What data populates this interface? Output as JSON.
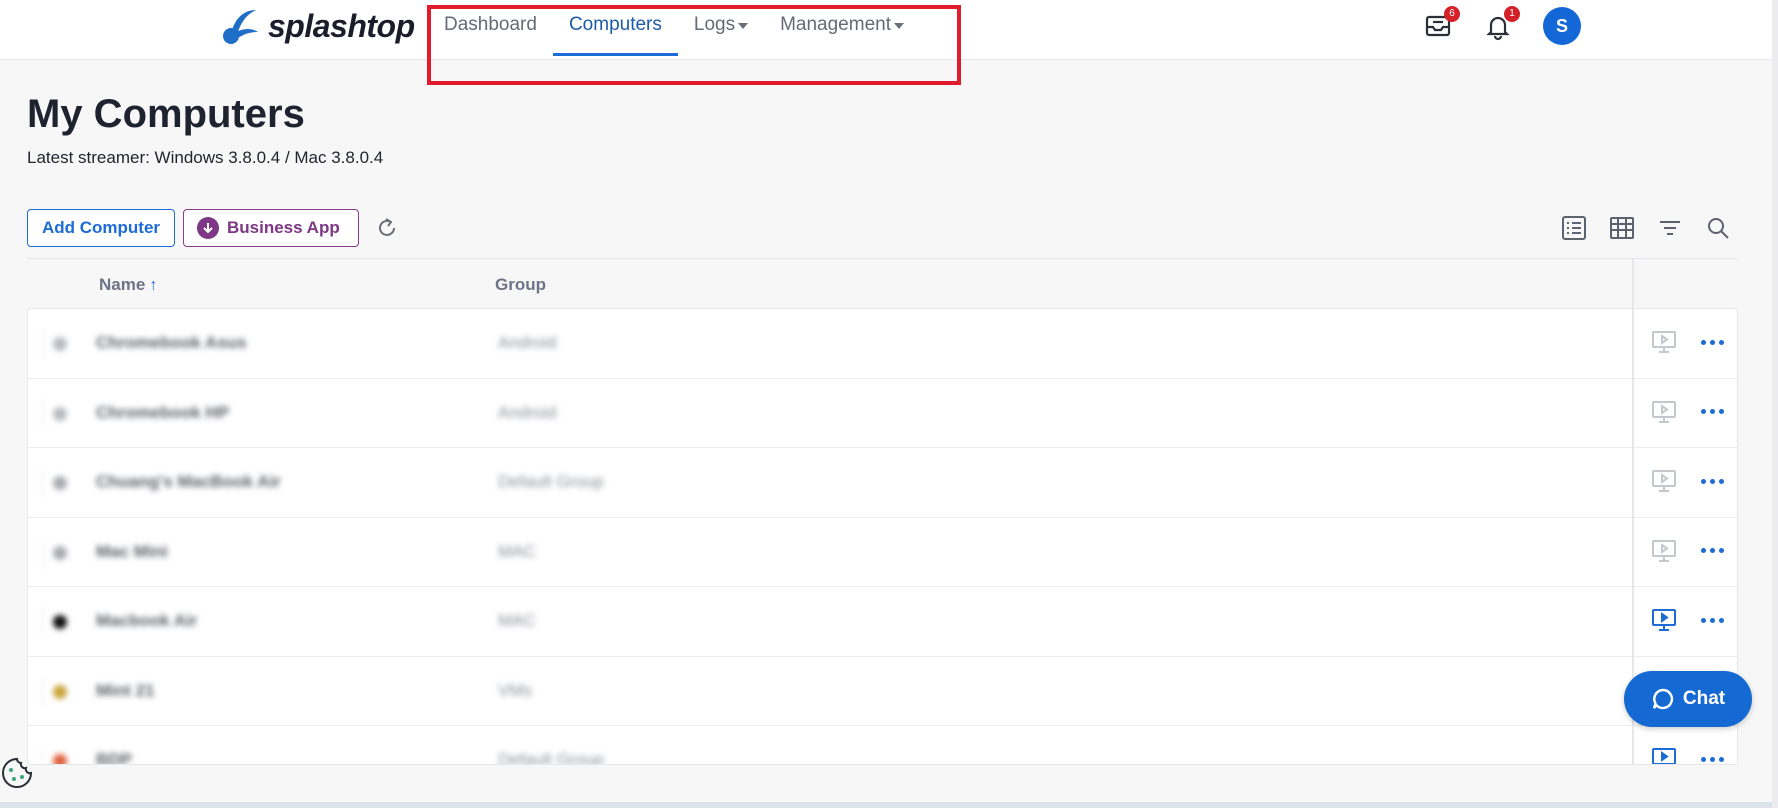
{
  "brand": {
    "name": "splashtop"
  },
  "nav": {
    "items": [
      {
        "label": "Dashboard",
        "active": false,
        "dropdown": false
      },
      {
        "label": "Computers",
        "active": true,
        "dropdown": false
      },
      {
        "label": "Logs",
        "active": false,
        "dropdown": true
      },
      {
        "label": "Management",
        "active": false,
        "dropdown": true
      }
    ]
  },
  "header": {
    "inbox_badge": "6",
    "notifications_badge": "1",
    "avatar_initial": "S"
  },
  "page": {
    "title": "My Computers",
    "subtitle": "Latest streamer: Windows 3.8.0.4 / Mac 3.8.0.4"
  },
  "toolbar": {
    "add_label": "Add Computer",
    "business_app_label": "Business App"
  },
  "table": {
    "columns": {
      "name": "Name",
      "group": "Group"
    },
    "sort_indicator": "↑",
    "rows": [
      {
        "name": "Chromebook Asus",
        "group": "Android",
        "connect_enabled": false
      },
      {
        "name": "Chromebook HP",
        "group": "Android",
        "connect_enabled": false
      },
      {
        "name": "Chuang's MacBook Air",
        "group": "Default Group",
        "connect_enabled": false
      },
      {
        "name": "Mac Mini",
        "group": "MAC",
        "connect_enabled": false
      },
      {
        "name": "Macbook Air",
        "group": "MAC",
        "connect_enabled": true
      },
      {
        "name": "Mint 21",
        "group": "VMs",
        "connect_enabled": true
      },
      {
        "name": "BDP",
        "group": "Default Group",
        "connect_enabled": true
      }
    ]
  },
  "chat": {
    "label": "Chat"
  },
  "colors": {
    "accent": "#1c6bd6",
    "business": "#7d3784",
    "badge": "#d42027",
    "highlight": "#e21b2d"
  }
}
